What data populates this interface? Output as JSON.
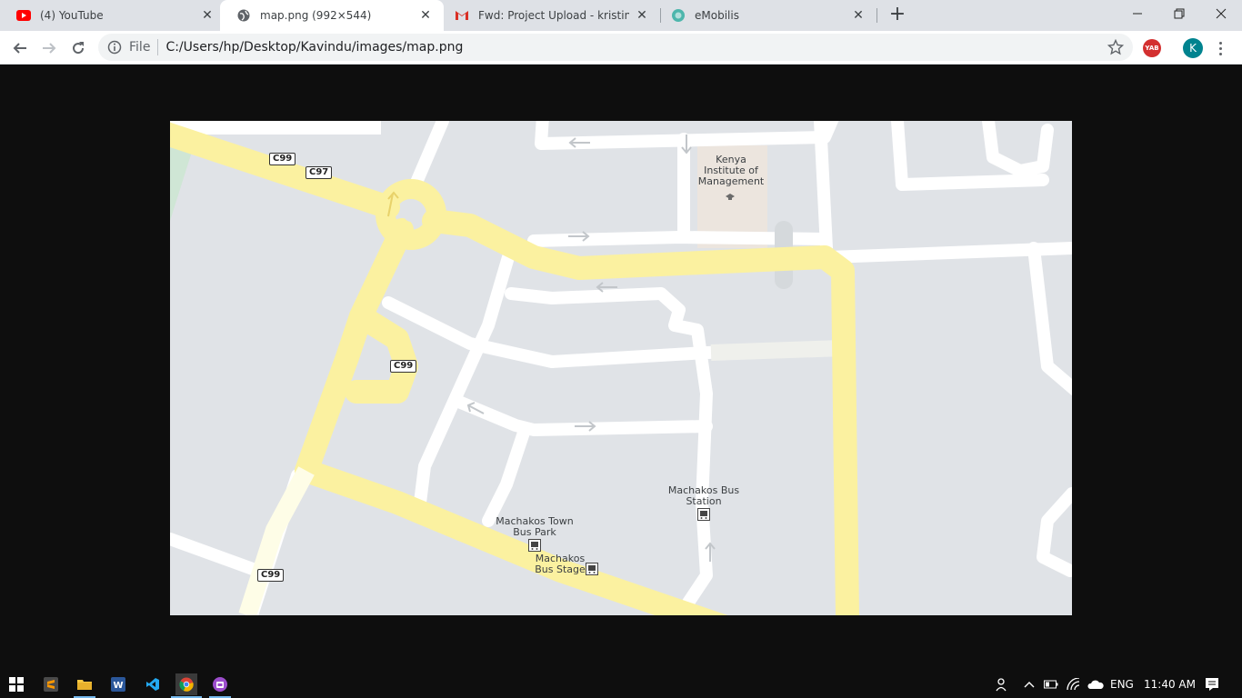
{
  "tabs": [
    {
      "title": "(4) YouTube",
      "icon": "youtube-icon"
    },
    {
      "title": "map.png (992×544)",
      "icon": "globe-icon"
    },
    {
      "title": "Fwd: Project Upload - kristinekak",
      "icon": "gmail-icon"
    },
    {
      "title": "eMobilis",
      "icon": "emobilis-icon"
    }
  ],
  "omnibox": {
    "scheme_label": "File",
    "url": "C:/Users/hp/Desktop/Kavindu/images/map.png"
  },
  "extensions": {
    "yab_label": "YAB"
  },
  "profile": {
    "initial": "K"
  },
  "map": {
    "poi": {
      "kenya_institute": "Kenya Institute of Management",
      "machakos_bus_station": "Machakos Bus Station",
      "machakos_town_bus_park": "Machakos Town Bus Park",
      "machakos_bus_stage": "Machakos Bus Stage"
    },
    "shields": [
      "C99",
      "C97",
      "C99",
      "C99"
    ]
  },
  "taskbar": {
    "language": "ENG",
    "time": "11:40 AM",
    "pinned": [
      "start-icon",
      "sublime-icon",
      "file-explorer-icon",
      "word-icon",
      "vscode-icon",
      "chrome-icon",
      "app-icon"
    ]
  }
}
